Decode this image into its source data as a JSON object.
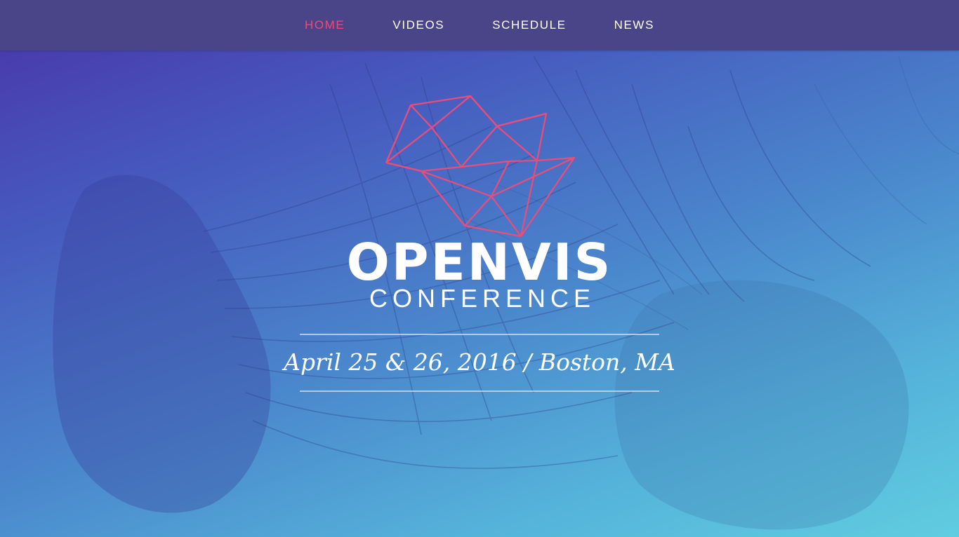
{
  "nav": {
    "items": [
      {
        "label": "HOME",
        "active": true
      },
      {
        "label": "VIDEOS",
        "active": false
      },
      {
        "label": "SCHEDULE",
        "active": false
      },
      {
        "label": "NEWS",
        "active": false
      }
    ],
    "active_color": "#ea4d7b",
    "background": "#4a4488"
  },
  "hero": {
    "logo_icon": "geometric-wireframe-logo",
    "logo_color": "#ea4d7b",
    "title": "OPENVIS",
    "subtitle": "CONFERENCE",
    "date_location": "April 25 & 26, 2016 / Boston, MA",
    "background_image": "jellyfish-photo",
    "gradient_colors": [
      "#4a34a8",
      "#4a86cc",
      "#60cde0"
    ]
  }
}
